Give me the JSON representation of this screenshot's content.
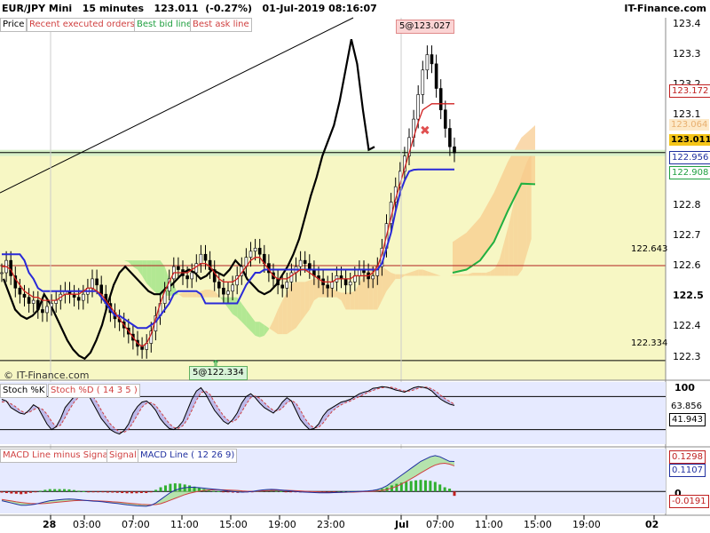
{
  "header": {
    "title": "EUR/JPY Mini   15 minutes   123.011  (-0.27%)   01-Jul-2019 08:16:07",
    "brand": "IT-Finance.com"
  },
  "main_legend": [
    "Price",
    "Recent executed orders",
    "Best bid line",
    "Best ask line"
  ],
  "main_legend_colors": [
    "#000000",
    "#d04040",
    "#20a040",
    "#d04040"
  ],
  "watermark": "© IT-Finance.com",
  "stoch_legend": [
    "Stoch %K",
    "Stoch %D ( 14 3 5 )"
  ],
  "stoch_legend_colors": [
    "#000000",
    "#d04040"
  ],
  "macd_legend": [
    "MACD Line minus Signal",
    "Signal",
    "MACD Line ( 12 26 9)"
  ],
  "macd_legend_colors": [
    "#d04040",
    "#d04040",
    "#2030a0"
  ],
  "price_axis_labels": [
    "123.4",
    "123.3",
    "123.2",
    "123.1",
    "123.0",
    "122.9",
    "122.8",
    "122.7",
    "122.6",
    "122.5",
    "122.4",
    "122.3"
  ],
  "price_tags": [
    {
      "label": "123.172",
      "bg": "#ffffff",
      "fg": "#c02020"
    },
    {
      "label": "123.064",
      "bg": "#fde9c8",
      "fg": "#e8b070"
    },
    {
      "label": "123.011",
      "bg": "#f5c518",
      "fg": "#000000"
    },
    {
      "label": "122.956",
      "bg": "#ffffff",
      "fg": "#2030a0"
    },
    {
      "label": "122.908",
      "bg": "#ffffff",
      "fg": "#20a040"
    }
  ],
  "horizontal_lines": [
    {
      "label": "122.643",
      "value": 122.643
    },
    {
      "label": "122.334",
      "value": 122.334
    }
  ],
  "annotations": {
    "top": "5@123.027",
    "bottom": "5@122.334"
  },
  "stoch_axis": [
    "100"
  ],
  "stoch_tags": [
    {
      "label": "63.856",
      "bg": "#ffffff",
      "fg": "#000000"
    },
    {
      "label": "41.943",
      "bg": "#ffffff",
      "fg": "#000000"
    }
  ],
  "macd_axis": [
    "0"
  ],
  "macd_tags": [
    {
      "label": "0.1298",
      "bg": "#ffffff",
      "fg": "#c02020"
    },
    {
      "label": "0.1107",
      "bg": "#ffffff",
      "fg": "#2030a0"
    },
    {
      "label": "-0.0191",
      "bg": "#ffffff",
      "fg": "#c02020"
    }
  ],
  "time_labels": [
    "28",
    "03:00",
    "07:00",
    "11:00",
    "15:00",
    "19:00",
    "23:00",
    "Jul",
    "07:00",
    "11:00",
    "15:00",
    "19:00",
    "02"
  ],
  "chart_data": [
    {
      "type": "line",
      "title": "EUR/JPY Mini 15 minutes",
      "ylim": [
        122.27,
        123.45
      ],
      "series": [
        {
          "name": "Price",
          "color": "#000000"
        }
      ],
      "close": [
        122.62,
        122.66,
        122.61,
        122.57,
        122.55,
        122.54,
        122.52,
        122.53,
        122.5,
        122.49,
        122.51,
        122.52,
        122.53,
        122.55,
        122.56,
        122.55,
        122.54,
        122.53,
        122.55,
        122.57,
        122.6,
        122.58,
        122.55,
        122.52,
        122.49,
        122.47,
        122.46,
        122.44,
        122.42,
        122.4,
        122.38,
        122.37,
        122.39,
        122.43,
        122.48,
        122.52,
        122.56,
        122.6,
        122.64,
        122.63,
        122.61,
        122.6,
        122.62,
        122.65,
        122.68,
        122.66,
        122.63,
        122.59,
        122.57,
        122.55,
        122.56,
        122.58,
        122.61,
        122.64,
        122.67,
        122.69,
        122.7,
        122.68,
        122.65,
        122.62,
        122.6,
        122.58,
        122.57,
        122.59,
        122.62,
        122.64,
        122.66,
        122.65,
        122.63,
        122.61,
        122.6,
        122.58,
        122.57,
        122.59,
        122.61,
        122.6,
        122.58,
        122.59,
        122.61,
        122.63,
        122.62,
        122.6,
        122.61,
        122.64,
        122.7,
        122.78,
        122.85,
        122.9,
        122.95,
        123.0,
        123.06,
        123.12,
        123.2,
        123.28,
        123.33,
        123.3,
        123.22,
        123.15,
        123.09,
        123.03,
        123.01
      ],
      "tenkan": [
        122.64,
        122.64,
        122.63,
        122.6,
        122.58,
        122.56,
        122.55,
        122.54,
        122.54,
        122.53,
        122.53,
        122.53,
        122.53,
        122.54,
        122.55,
        122.55,
        122.55,
        122.55,
        122.56,
        122.57,
        122.57,
        122.56,
        122.55,
        122.53,
        122.51,
        122.49,
        122.47,
        122.45,
        122.43,
        122.41,
        122.39,
        122.38,
        122.39,
        122.42,
        122.47,
        122.52,
        122.56,
        122.59,
        122.62,
        122.62,
        122.62,
        122.62,
        122.63,
        122.64,
        122.65,
        122.65,
        122.64,
        122.62,
        122.6,
        122.59,
        122.59,
        122.59,
        122.6,
        122.62,
        122.64,
        122.66,
        122.67,
        122.67,
        122.65,
        122.63,
        122.61,
        122.6,
        122.6,
        122.6,
        122.61,
        122.62,
        122.63,
        122.63,
        122.62,
        122.61,
        122.6,
        122.59,
        122.59,
        122.59,
        122.6,
        122.6,
        122.6,
        122.6,
        122.61,
        122.61,
        122.61,
        122.61,
        122.62,
        122.64,
        122.68,
        122.74,
        122.8,
        122.86,
        122.91,
        122.96,
        123.01,
        123.06,
        123.11,
        123.15,
        123.16,
        123.17,
        123.17,
        123.17,
        123.17,
        123.17,
        123.17
      ],
      "kijun": [
        122.68,
        122.68,
        122.68,
        122.68,
        122.68,
        122.66,
        122.62,
        122.6,
        122.57,
        122.56,
        122.56,
        122.56,
        122.56,
        122.56,
        122.56,
        122.56,
        122.56,
        122.56,
        122.56,
        122.56,
        122.56,
        122.56,
        122.54,
        122.52,
        122.5,
        122.48,
        122.48,
        122.47,
        122.46,
        122.45,
        122.44,
        122.44,
        122.44,
        122.45,
        122.46,
        122.48,
        122.5,
        122.52,
        122.55,
        122.56,
        122.56,
        122.56,
        122.56,
        122.56,
        122.55,
        122.52,
        122.52,
        122.52,
        122.52,
        122.52,
        122.52,
        122.52,
        122.52,
        122.55,
        122.58,
        122.6,
        122.62,
        122.62,
        122.63,
        122.63,
        122.63,
        122.63,
        122.63,
        122.63,
        122.63,
        122.63,
        122.63,
        122.63,
        122.63,
        122.63,
        122.63,
        122.63,
        122.63,
        122.63,
        122.63,
        122.63,
        122.63,
        122.63,
        122.63,
        122.63,
        122.63,
        122.63,
        122.63,
        122.63,
        122.65,
        122.7,
        122.75,
        122.82,
        122.88,
        122.92,
        122.95,
        122.955,
        122.956,
        122.956,
        122.956,
        122.956,
        122.956,
        122.956,
        122.956,
        122.956,
        122.956
      ],
      "chikou_span": [
        122.6,
        122.55,
        122.5,
        122.48,
        122.47,
        122.48,
        122.5,
        122.55,
        122.52,
        122.48,
        122.44,
        122.4,
        122.37,
        122.35,
        122.34,
        122.36,
        122.4,
        122.45,
        122.52,
        122.58,
        122.62,
        122.64,
        122.62,
        122.6,
        122.58,
        122.56,
        122.55,
        122.55,
        122.57,
        122.58,
        122.6,
        122.62,
        122.63,
        122.62,
        122.6,
        122.61,
        122.63,
        122.62,
        122.61,
        122.63,
        122.66,
        122.64,
        122.6,
        122.58,
        122.56,
        122.55,
        122.56,
        122.58,
        122.61,
        122.64,
        122.68,
        122.73,
        122.8,
        122.87,
        122.93,
        123.0,
        123.05,
        123.1,
        123.18,
        123.28,
        123.38,
        123.3,
        123.15,
        123.02,
        123.03
      ]
    },
    {
      "type": "line",
      "title": "Stoch %K / Stoch %D ( 14 3 5 )",
      "ylim": [
        0,
        100
      ],
      "k": [
        75,
        72,
        60,
        55,
        50,
        48,
        55,
        65,
        60,
        45,
        30,
        20,
        25,
        40,
        60,
        70,
        80,
        88,
        92,
        85,
        70,
        55,
        40,
        30,
        20,
        15,
        12,
        18,
        30,
        50,
        62,
        70,
        72,
        65,
        55,
        40,
        30,
        22,
        20,
        25,
        35,
        55,
        75,
        90,
        96,
        85,
        70,
        55,
        45,
        35,
        30,
        38,
        50,
        68,
        80,
        85,
        78,
        68,
        60,
        55,
        50,
        58,
        70,
        78,
        72,
        55,
        38,
        28,
        20,
        22,
        30,
        45,
        55,
        60,
        65,
        70,
        72,
        75,
        80,
        85,
        88,
        90,
        95,
        96,
        98,
        97,
        95,
        92,
        90,
        88,
        92,
        96,
        98,
        97,
        95,
        90,
        82,
        75,
        70,
        66,
        63.856
      ],
      "d": [
        70,
        71,
        67,
        62,
        55,
        51,
        51,
        56,
        60,
        57,
        48,
        35,
        25,
        28,
        42,
        57,
        70,
        79,
        87,
        88,
        82,
        70,
        55,
        42,
        30,
        22,
        16,
        15,
        20,
        33,
        47,
        61,
        68,
        69,
        64,
        53,
        42,
        31,
        24,
        22,
        27,
        38,
        55,
        73,
        87,
        90,
        84,
        70,
        57,
        45,
        37,
        34,
        39,
        52,
        66,
        78,
        81,
        77,
        69,
        61,
        55,
        54,
        59,
        69,
        73,
        68,
        55,
        40,
        29,
        23,
        24,
        32,
        43,
        53,
        60,
        65,
        69,
        72,
        76,
        80,
        84,
        88,
        91,
        94,
        96,
        97,
        97,
        95,
        92,
        90,
        90,
        92,
        95,
        97,
        97,
        94,
        89,
        82,
        76,
        71,
        66
      ]
    },
    {
      "type": "bar",
      "title": "MACD Line ( 12 26 9)",
      "macd": [
        -0.04,
        -0.045,
        -0.05,
        -0.055,
        -0.06,
        -0.06,
        -0.058,
        -0.055,
        -0.05,
        -0.045,
        -0.04,
        -0.038,
        -0.036,
        -0.034,
        -0.033,
        -0.034,
        -0.036,
        -0.038,
        -0.04,
        -0.042,
        -0.043,
        -0.045,
        -0.048,
        -0.05,
        -0.052,
        -0.055,
        -0.058,
        -0.06,
        -0.062,
        -0.063,
        -0.064,
        -0.06,
        -0.05,
        -0.035,
        -0.02,
        -0.005,
        0.005,
        0.012,
        0.016,
        0.018,
        0.018,
        0.016,
        0.014,
        0.012,
        0.01,
        0.008,
        0.005,
        0.002,
        0.0,
        -0.002,
        -0.003,
        -0.002,
        0.0,
        0.003,
        0.006,
        0.008,
        0.009,
        0.008,
        0.006,
        0.004,
        0.002,
        0.0,
        -0.002,
        -0.003,
        -0.004,
        -0.005,
        -0.006,
        -0.006,
        -0.006,
        -0.005,
        -0.004,
        -0.003,
        -0.002,
        -0.001,
        0.0,
        0.001,
        0.002,
        0.004,
        0.008,
        0.015,
        0.025,
        0.04,
        0.055,
        0.07,
        0.085,
        0.1,
        0.115,
        0.13,
        0.14,
        0.15,
        0.155,
        0.15,
        0.14,
        0.13,
        0.1298
      ],
      "signal": [
        -0.035,
        -0.038,
        -0.041,
        -0.045,
        -0.048,
        -0.05,
        -0.052,
        -0.053,
        -0.053,
        -0.052,
        -0.05,
        -0.048,
        -0.046,
        -0.044,
        -0.042,
        -0.04,
        -0.039,
        -0.039,
        -0.039,
        -0.04,
        -0.041,
        -0.042,
        -0.043,
        -0.045,
        -0.046,
        -0.048,
        -0.05,
        -0.052,
        -0.054,
        -0.056,
        -0.057,
        -0.058,
        -0.057,
        -0.053,
        -0.046,
        -0.038,
        -0.03,
        -0.022,
        -0.014,
        -0.008,
        -0.003,
        0.001,
        0.004,
        0.006,
        0.007,
        0.007,
        0.007,
        0.006,
        0.005,
        0.004,
        0.002,
        0.001,
        0.001,
        0.001,
        0.002,
        0.003,
        0.004,
        0.005,
        0.005,
        0.005,
        0.004,
        0.003,
        0.002,
        0.001,
        0.0,
        -0.001,
        -0.002,
        -0.003,
        -0.004,
        -0.004,
        -0.004,
        -0.004,
        -0.003,
        -0.003,
        -0.002,
        -0.001,
        0.0,
        0.001,
        0.002,
        0.004,
        0.008,
        0.014,
        0.022,
        0.032,
        0.043,
        0.055,
        0.067,
        0.08,
        0.092,
        0.104,
        0.114,
        0.12,
        0.122,
        0.118,
        0.1107
      ],
      "histogram": [
        -0.005,
        -0.007,
        -0.009,
        -0.01,
        -0.012,
        -0.01,
        -0.006,
        -0.002,
        0.003,
        0.007,
        0.01,
        0.01,
        0.01,
        0.01,
        0.009,
        0.006,
        0.003,
        0.001,
        -0.001,
        -0.002,
        -0.002,
        -0.003,
        -0.005,
        -0.005,
        -0.006,
        -0.007,
        -0.008,
        -0.008,
        -0.008,
        -0.007,
        -0.007,
        -0.002,
        0.007,
        0.018,
        0.026,
        0.033,
        0.035,
        0.034,
        0.03,
        0.026,
        0.021,
        0.015,
        0.01,
        0.006,
        0.003,
        0.001,
        -0.002,
        -0.004,
        -0.005,
        -0.006,
        -0.005,
        -0.003,
        -0.001,
        0.002,
        0.004,
        0.005,
        0.005,
        0.003,
        0.001,
        -0.001,
        -0.002,
        -0.003,
        -0.004,
        -0.004,
        -0.004,
        -0.004,
        -0.004,
        -0.003,
        -0.002,
        -0.001,
        0.0,
        0.001,
        0.001,
        0.002,
        0.002,
        0.002,
        0.002,
        0.003,
        0.006,
        0.011,
        0.017,
        0.026,
        0.033,
        0.038,
        0.042,
        0.045,
        0.048,
        0.05,
        0.048,
        0.046,
        0.041,
        0.03,
        0.018,
        0.012,
        -0.0191
      ]
    }
  ]
}
